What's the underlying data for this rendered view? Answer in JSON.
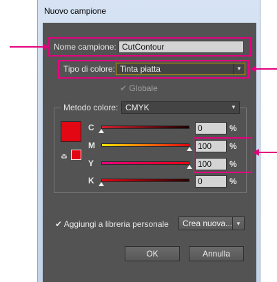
{
  "window": {
    "title": "Nuovo campione"
  },
  "swatch_name": {
    "label": "Nome campione:",
    "value": "CutContour"
  },
  "color_type": {
    "label": "Tipo di colore:",
    "selected": "Tinta piatta"
  },
  "global": {
    "label": "Globale",
    "checked": true,
    "enabled": false
  },
  "color_mode": {
    "label": "Metodo colore:",
    "selected": "CMYK"
  },
  "channels": [
    {
      "name": "C",
      "value": "0",
      "unit": "%"
    },
    {
      "name": "M",
      "value": "100",
      "unit": "%"
    },
    {
      "name": "Y",
      "value": "100",
      "unit": "%"
    },
    {
      "name": "K",
      "value": "0",
      "unit": "%"
    }
  ],
  "add_to_library": {
    "label": "Aggiungi a libreria personale",
    "checked": true
  },
  "create_new": {
    "label": "Crea nuova..."
  },
  "buttons": {
    "ok": "OK",
    "cancel": "Annulla"
  },
  "colors": {
    "highlight": "#e4007f",
    "swatch_color": "#e30613",
    "dialog_bg": "#535353"
  }
}
